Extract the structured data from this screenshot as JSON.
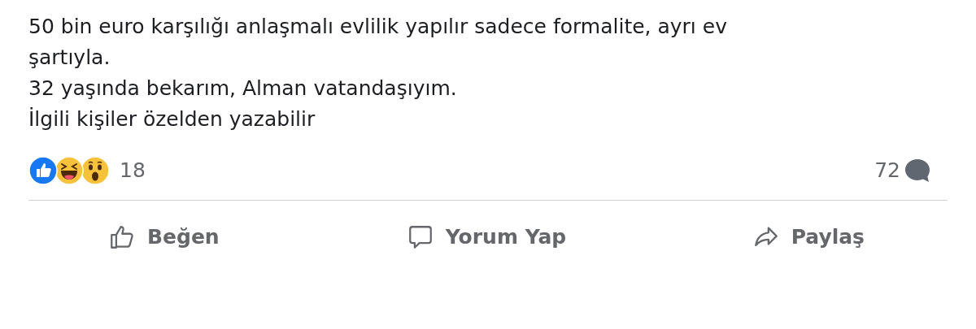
{
  "post": {
    "lines": [
      "50 bin euro karşılığı anlaşmalı evlilik yapılır sadece formalite, ayrı ev",
      "şartıyla.",
      "32 yaşında bekarım, Alman vatandaşıyım.",
      "İlgili kişiler özelden yazabilir"
    ]
  },
  "reactions": {
    "items": [
      {
        "kind": "like"
      },
      {
        "kind": "haha"
      },
      {
        "kind": "wow"
      }
    ],
    "count": "18"
  },
  "comments": {
    "count": "72"
  },
  "actions": [
    {
      "kind": "like",
      "label": "Beğen"
    },
    {
      "kind": "comment",
      "label": "Yorum Yap"
    },
    {
      "kind": "share",
      "label": "Paylaş"
    }
  ]
}
